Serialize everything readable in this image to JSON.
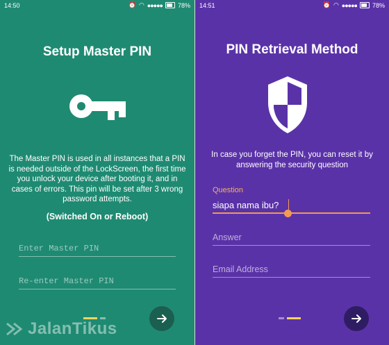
{
  "left_screen": {
    "status_time": "14:50",
    "battery": "78%",
    "title": "Setup Master PIN",
    "description": "The Master PIN is used in all instances that a PIN is needed outside of the LockScreen, the first time you unlock your device after booting it, and in cases of errors. This pin will be set after 3 wrong password attempts.",
    "note": "(Switched On or Reboot)",
    "pin_placeholder": "Enter Master PIN",
    "pin_confirm_placeholder": "Re-enter Master PIN",
    "watermark": "JalanTikus"
  },
  "right_screen": {
    "status_time": "14:51",
    "battery": "78%",
    "title": "PIN Retrieval Method",
    "description": "In case you forget the PIN, you can reset it by answering the security question",
    "question_label": "Question",
    "question_value": "siapa nama ibu?",
    "answer_placeholder": "Answer",
    "email_placeholder": "Email Address"
  },
  "icons": {
    "key": "key-icon",
    "shield": "shield-icon",
    "next": "arrow-right-icon"
  },
  "colors": {
    "left_bg": "#1f8a72",
    "right_bg": "#5a32a8",
    "accent_orange": "#f19a54",
    "pager_active": "#f7d35d"
  }
}
